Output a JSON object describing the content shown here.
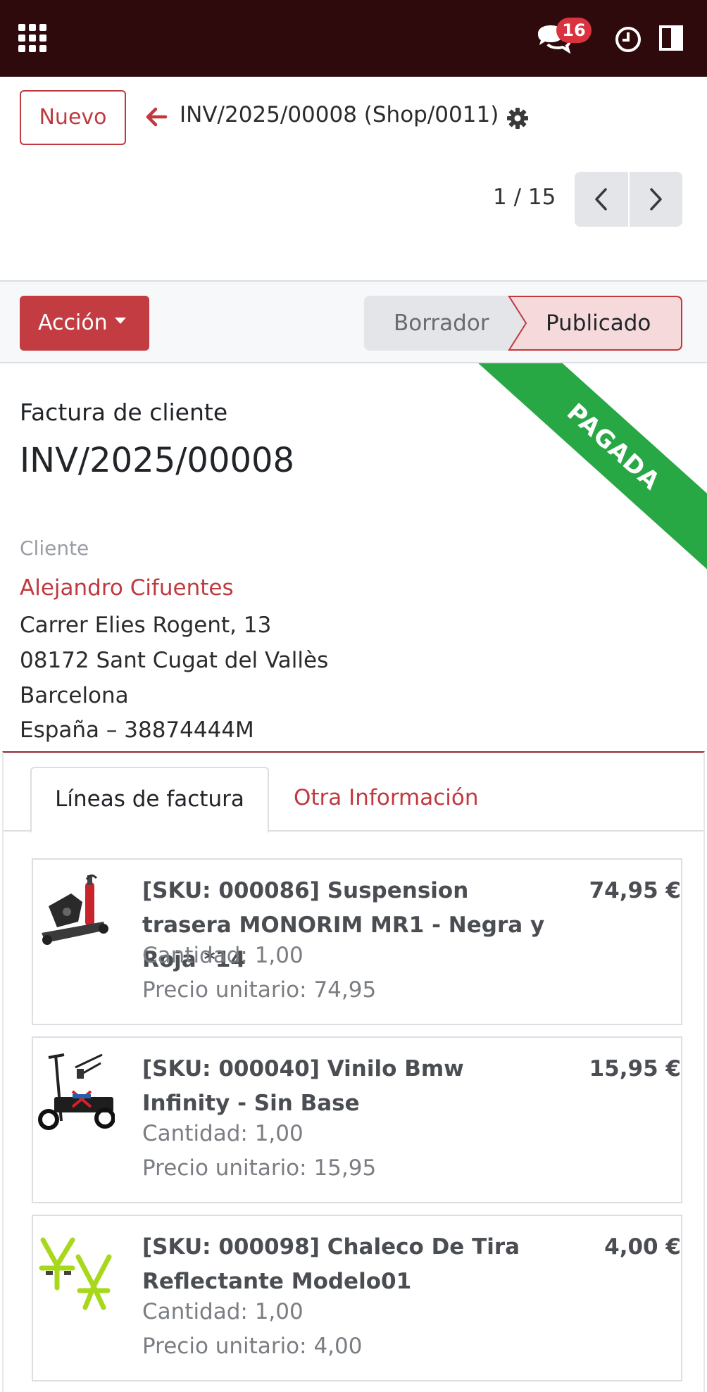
{
  "navbar": {
    "message_count": "16",
    "colors": {
      "background": "#2f0a0d",
      "badge": "#d9333f"
    }
  },
  "control_panel": {
    "new_button": "Nuevo",
    "breadcrumb": "INV/2025/00008 (Shop/0011)",
    "pager": "1 / 15"
  },
  "status_bar": {
    "action_button": "Acción",
    "steps": [
      "Borrador",
      "Publicado"
    ],
    "current_step": "Publicado"
  },
  "ribbon": {
    "label": "PAGADA",
    "color": "#28a745"
  },
  "document": {
    "subtitle": "Factura de cliente",
    "number": "INV/2025/00008",
    "customer_label": "Cliente",
    "customer_name": "Alejandro Cifuentes",
    "address": [
      "Carrer Elies Rogent, 13",
      "08172 Sant Cugat del Vallès",
      "Barcelona",
      "España – 38874444M"
    ]
  },
  "tabs": {
    "active": "Líneas de factura",
    "other": "Otra Información"
  },
  "lines": [
    {
      "title": "[SKU: 000086] Suspension trasera MONORIM MR1 - Negra y Roja *14",
      "price": "74,95 €",
      "quantity": "Cantidad: 1,00",
      "unit_price": "Precio unitario: 74,95",
      "image": "suspension-product-image"
    },
    {
      "title": "[SKU: 000040] Vinilo Bmw Infinity - Sin Base",
      "price": "15,95 €",
      "quantity": "Cantidad: 1,00",
      "unit_price": "Precio unitario: 15,95",
      "image": "scooter-product-image"
    },
    {
      "title": "[SKU: 000098] Chaleco De Tira Reflectante Modelo01",
      "price": "4,00 €",
      "quantity": "Cantidad: 1,00",
      "unit_price": "Precio unitario: 4,00",
      "image": "vest-product-image"
    }
  ]
}
